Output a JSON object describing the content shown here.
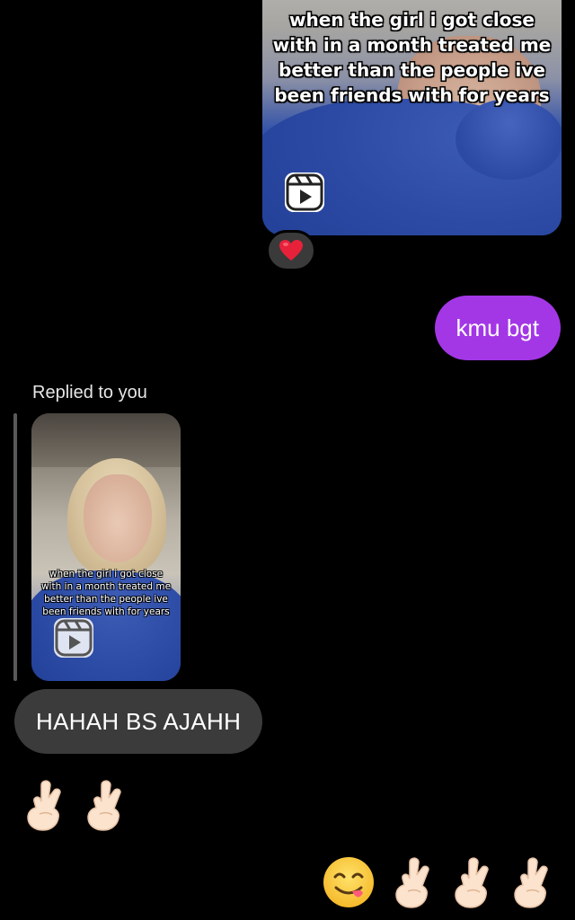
{
  "reel_top": {
    "caption": "when the girl i got close\nwith in a month treated me\nbetter than the people ive\nbeen friends with for years"
  },
  "reaction": {
    "icon": "red-heart-icon"
  },
  "my_message": {
    "text": "kmu bgt"
  },
  "reply": {
    "label": "Replied to you",
    "reel_caption": "when the girl i got close\nwith in a month treated me\nbetter than the people ive\nbeen friends with for years"
  },
  "their_message": {
    "text": "HAHAH BS AJAHH"
  },
  "emoji_row_left": [
    "crossed-fingers-icon",
    "crossed-fingers-icon"
  ],
  "emoji_row_right": [
    "face-savoring-food-icon",
    "crossed-fingers-icon",
    "crossed-fingers-icon",
    "crossed-fingers-icon"
  ],
  "colors": {
    "my_bubble": "#a337e6",
    "their_bubble": "#3b3b3b",
    "background": "#000000",
    "reaction_bg": "#3a3a3a"
  }
}
